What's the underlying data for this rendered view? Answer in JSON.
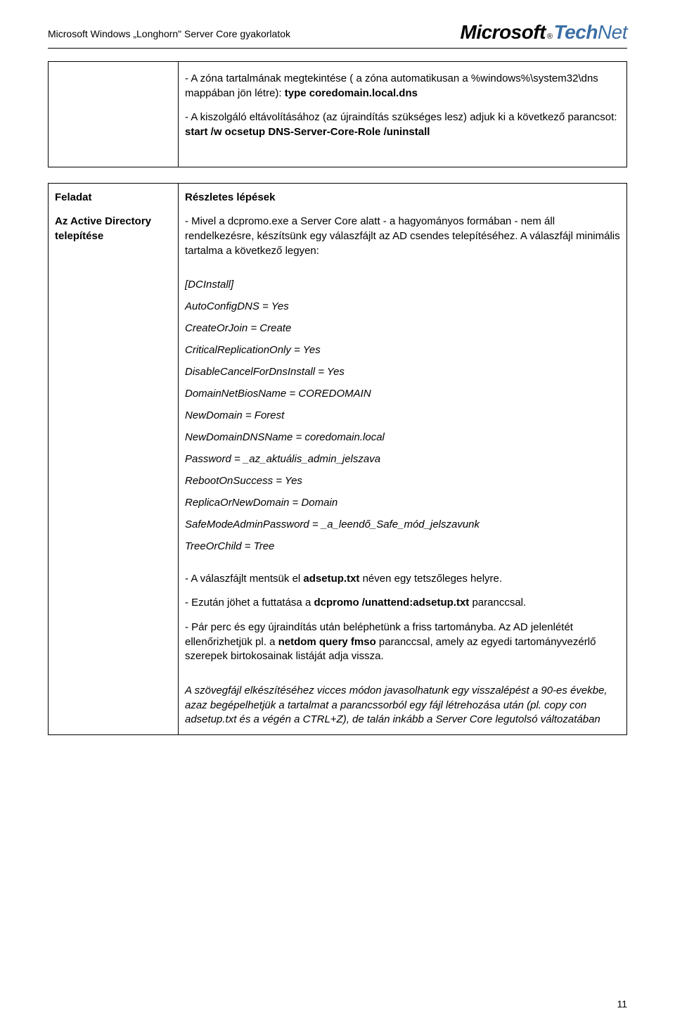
{
  "header": {
    "title": "Microsoft Windows „Longhorn\" Server Core gyakorlatok",
    "logo_ms": "Microsoft",
    "logo_reg": "®",
    "logo_tech": "Tech",
    "logo_net": "Net"
  },
  "row1": {
    "p1_pre": "- A zóna tartalmának megtekintése ( a zóna automatikusan a %windows%\\system32\\dns mappában jön létre): ",
    "p1_bold": "type coredomain.local.dns",
    "p2_pre": "- A kiszolgáló eltávolításához (az újraindítás szükséges lesz) adjuk ki a következő parancsot: ",
    "p2_bold": "start /w ocsetup DNS-Server-Core-Role /uninstall"
  },
  "row2": {
    "left1": "Feladat",
    "left2": "Az Active Directory telepítése",
    "right_title": "Részletes lépések",
    "p1": "- Mivel a dcpromo.exe a Server Core alatt - a hagyományos formában - nem áll rendelkezésre, készítsünk egy válaszfájlt az AD csendes telepítéséhez. A válaszfájl minimális tartalma a következő legyen:",
    "lines": [
      "[DCInstall]",
      "AutoConfigDNS = Yes",
      "CreateOrJoin = Create",
      "CriticalReplicationOnly = Yes",
      "DisableCancelForDnsInstall = Yes",
      "DomainNetBiosName = COREDOMAIN",
      "NewDomain = Forest",
      "NewDomainDNSName = coredomain.local",
      "Password = _az_aktuális_admin_jelszava",
      "RebootOnSuccess = Yes",
      "ReplicaOrNewDomain = Domain",
      "SafeModeAdminPassword = _a_leendő_Safe_mód_jelszavunk",
      "TreeOrChild = Tree"
    ],
    "p2a": "- A válaszfájlt mentsük el ",
    "p2b_bold": "adsetup.txt",
    "p2c": " néven egy tetszőleges helyre.",
    "p3a": "- Ezután jöhet a futtatása a ",
    "p3b_bold": "dcpromo /unattend:adsetup.txt",
    "p3c": " paranccsal.",
    "p4a": "- Pár perc és egy újraindítás után beléphetünk a friss tartományba. Az AD jelenlétét ellenőrizhetjük pl. a ",
    "p4b_bold": "netdom query fmso",
    "p4c": " paranccsal, amely az egyedi tartományvezérlő szerepek birtokosainak listáját adja vissza.",
    "p5_italic": "A szövegfájl elkészítéséhez vicces módon javasolhatunk egy visszalépést a 90-es évekbe, azaz begépelhetjük a tartalmat a parancssorból egy fájl létrehozása után (pl. copy con adsetup.txt és a végén a CTRL+Z), de talán inkább a Server Core legutolsó változatában"
  },
  "page_number": "11"
}
